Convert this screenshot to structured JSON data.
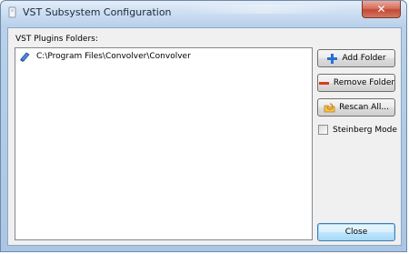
{
  "window": {
    "title": "VST Subsystem Configuration",
    "close_glyph": "✕"
  },
  "folders": {
    "label": "VST Plugins Folders:",
    "items": [
      {
        "path": "C:\\Program Files\\Convolver\\Convolver",
        "icon": "folder-icon"
      }
    ]
  },
  "buttons": {
    "add_folder": {
      "label": "Add Folder",
      "icon": "plus-icon",
      "color": "#2a6fd6"
    },
    "remove_folder": {
      "label": "Remove Folder",
      "icon": "minus-icon",
      "color": "#d83a1e"
    },
    "rescan_all": {
      "label": "Rescan All...",
      "icon": "rescan-folder-icon"
    },
    "close": {
      "label": "Close"
    }
  },
  "options": {
    "steinberg_mode": {
      "label": "Steinberg Mode",
      "checked": false
    }
  },
  "colors": {
    "accent_focus": "#3c7fb1",
    "frame": "#aac6e4",
    "close_button_red": "#c24a35"
  }
}
